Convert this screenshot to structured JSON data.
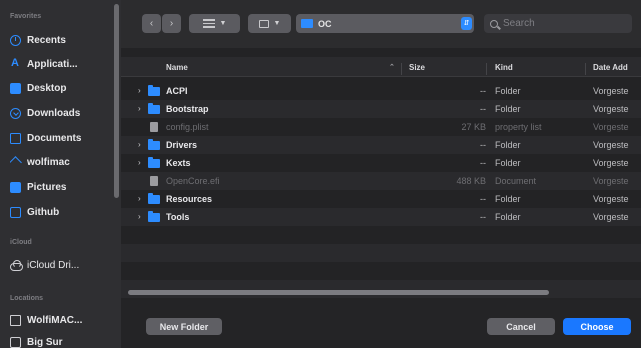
{
  "sidebar": {
    "favorites_label": "Favorites",
    "favorites": [
      {
        "label": "Recents",
        "icon": "clock-icon"
      },
      {
        "label": "Applicati...",
        "icon": "applications-icon"
      },
      {
        "label": "Desktop",
        "icon": "desktop-icon"
      },
      {
        "label": "Downloads",
        "icon": "downloads-icon"
      },
      {
        "label": "Documents",
        "icon": "documents-icon"
      },
      {
        "label": "wolfimac",
        "icon": "home-icon"
      },
      {
        "label": "Pictures",
        "icon": "pictures-icon"
      },
      {
        "label": "Github",
        "icon": "folder-icon"
      }
    ],
    "icloud_label": "iCloud",
    "icloud": [
      {
        "label": "iCloud Dri...",
        "icon": "cloud-icon"
      }
    ],
    "locations_label": "Locations",
    "locations": [
      {
        "label": "WolfiMAC...",
        "icon": "computer-icon"
      },
      {
        "label": "Big Sur",
        "icon": "disk-icon"
      }
    ]
  },
  "toolbar": {
    "back_icon": "chevron-left-icon",
    "forward_icon": "chevron-right-icon",
    "current_folder": "OC",
    "search_placeholder": "Search"
  },
  "columns": {
    "name": "Name",
    "size": "Size",
    "kind": "Kind",
    "date": "Date Add"
  },
  "files": [
    {
      "name": "ACPI",
      "size": "--",
      "kind": "Folder",
      "date": "Vorgeste",
      "type": "folder",
      "dim": false
    },
    {
      "name": "Bootstrap",
      "size": "--",
      "kind": "Folder",
      "date": "Vorgeste",
      "type": "folder",
      "dim": false
    },
    {
      "name": "config.plist",
      "size": "27 KB",
      "kind": "property list",
      "date": "Vorgeste",
      "type": "file",
      "dim": true
    },
    {
      "name": "Drivers",
      "size": "--",
      "kind": "Folder",
      "date": "Vorgeste",
      "type": "folder",
      "dim": false
    },
    {
      "name": "Kexts",
      "size": "--",
      "kind": "Folder",
      "date": "Vorgeste",
      "type": "folder",
      "dim": false
    },
    {
      "name": "OpenCore.efi",
      "size": "488 KB",
      "kind": "Document",
      "date": "Vorgeste",
      "type": "file",
      "dim": true
    },
    {
      "name": "Resources",
      "size": "--",
      "kind": "Folder",
      "date": "Vorgeste",
      "type": "folder",
      "dim": false
    },
    {
      "name": "Tools",
      "size": "--",
      "kind": "Folder",
      "date": "Vorgeste",
      "type": "folder",
      "dim": false
    }
  ],
  "buttons": {
    "new_folder": "New Folder",
    "cancel": "Cancel",
    "choose": "Choose"
  },
  "colors": {
    "accent": "#1a78ff",
    "folder": "#2d8cff"
  }
}
